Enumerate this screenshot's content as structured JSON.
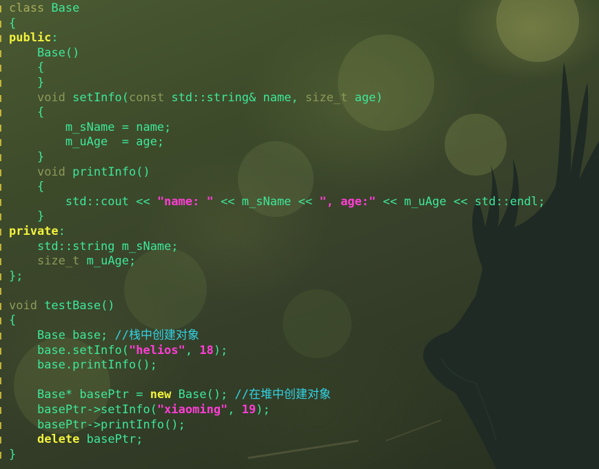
{
  "editor": {
    "language": "C++",
    "colors": {
      "background": "#3a4628",
      "identifier": "#3ee89a",
      "keyword": "#a9ad5a",
      "access_specifier": "#f2f23c",
      "string_literal": "#ff3dd6",
      "comment": "#32d4e6",
      "gutter_marker": "#d9c43a"
    },
    "background_image": "forest-with-deer-silhouette",
    "lines": [
      [
        {
          "t": "class ",
          "c": "kw"
        },
        {
          "t": "Base",
          "c": "ident"
        }
      ],
      [
        {
          "t": "{",
          "c": "punct"
        }
      ],
      [
        {
          "t": "public",
          "c": "access"
        },
        {
          "t": ":",
          "c": "punct"
        }
      ],
      [
        {
          "t": "    Base()",
          "c": "ident"
        }
      ],
      [
        {
          "t": "    {",
          "c": "punct"
        }
      ],
      [
        {
          "t": "    }",
          "c": "punct"
        }
      ],
      [
        {
          "t": "    ",
          "c": "punct"
        },
        {
          "t": "void",
          "c": "ptype"
        },
        {
          "t": " setInfo(",
          "c": "ident"
        },
        {
          "t": "const",
          "c": "ptype"
        },
        {
          "t": " std::string& name, ",
          "c": "ident"
        },
        {
          "t": "size_t",
          "c": "ptype"
        },
        {
          "t": " age)",
          "c": "ident"
        }
      ],
      [
        {
          "t": "    {",
          "c": "punct"
        }
      ],
      [
        {
          "t": "        m_sName = name;",
          "c": "ident"
        }
      ],
      [
        {
          "t": "        m_uAge  = age;",
          "c": "ident"
        }
      ],
      [
        {
          "t": "    }",
          "c": "punct"
        }
      ],
      [
        {
          "t": "    ",
          "c": "punct"
        },
        {
          "t": "void",
          "c": "ptype"
        },
        {
          "t": " printInfo()",
          "c": "ident"
        }
      ],
      [
        {
          "t": "    {",
          "c": "punct"
        }
      ],
      [
        {
          "t": "        std::cout << ",
          "c": "ident"
        },
        {
          "t": "\"name: \"",
          "c": "str"
        },
        {
          "t": " << m_sName << ",
          "c": "ident"
        },
        {
          "t": "\", age:\"",
          "c": "str"
        },
        {
          "t": " << m_uAge << std::endl;",
          "c": "ident"
        }
      ],
      [
        {
          "t": "    }",
          "c": "punct"
        }
      ],
      [
        {
          "t": "private",
          "c": "access"
        },
        {
          "t": ":",
          "c": "punct"
        }
      ],
      [
        {
          "t": "    std::string m_sName;",
          "c": "ident"
        }
      ],
      [
        {
          "t": "    ",
          "c": "punct"
        },
        {
          "t": "size_t",
          "c": "ptype"
        },
        {
          "t": " m_uAge;",
          "c": "ident"
        }
      ],
      [
        {
          "t": "};",
          "c": "punct"
        }
      ],
      [
        {
          "t": "",
          "c": "punct"
        }
      ],
      [
        {
          "t": "void",
          "c": "ptype"
        },
        {
          "t": " testBase()",
          "c": "ident"
        }
      ],
      [
        {
          "t": "{",
          "c": "punct"
        }
      ],
      [
        {
          "t": "    Base base; ",
          "c": "ident"
        },
        {
          "t": "//栈中创建对象",
          "c": "cmt"
        }
      ],
      [
        {
          "t": "    base.setInfo(",
          "c": "ident"
        },
        {
          "t": "\"helios\"",
          "c": "str"
        },
        {
          "t": ", ",
          "c": "ident"
        },
        {
          "t": "18",
          "c": "num"
        },
        {
          "t": ");",
          "c": "ident"
        }
      ],
      [
        {
          "t": "    base.printInfo();",
          "c": "ident"
        }
      ],
      [
        {
          "t": "",
          "c": "punct"
        }
      ],
      [
        {
          "t": "    Base* basePtr = ",
          "c": "ident"
        },
        {
          "t": "new",
          "c": "new"
        },
        {
          "t": " Base(); ",
          "c": "ident"
        },
        {
          "t": "//在堆中创建对象",
          "c": "cmt"
        }
      ],
      [
        {
          "t": "    basePtr->setInfo(",
          "c": "ident"
        },
        {
          "t": "\"xiaoming\"",
          "c": "str"
        },
        {
          "t": ", ",
          "c": "ident"
        },
        {
          "t": "19",
          "c": "num"
        },
        {
          "t": ");",
          "c": "ident"
        }
      ],
      [
        {
          "t": "    basePtr->printInfo();",
          "c": "ident"
        }
      ],
      [
        {
          "t": "    ",
          "c": "punct"
        },
        {
          "t": "delete",
          "c": "new"
        },
        {
          "t": " basePtr;",
          "c": "ident"
        }
      ],
      [
        {
          "t": "}",
          "c": "punct"
        }
      ]
    ]
  }
}
